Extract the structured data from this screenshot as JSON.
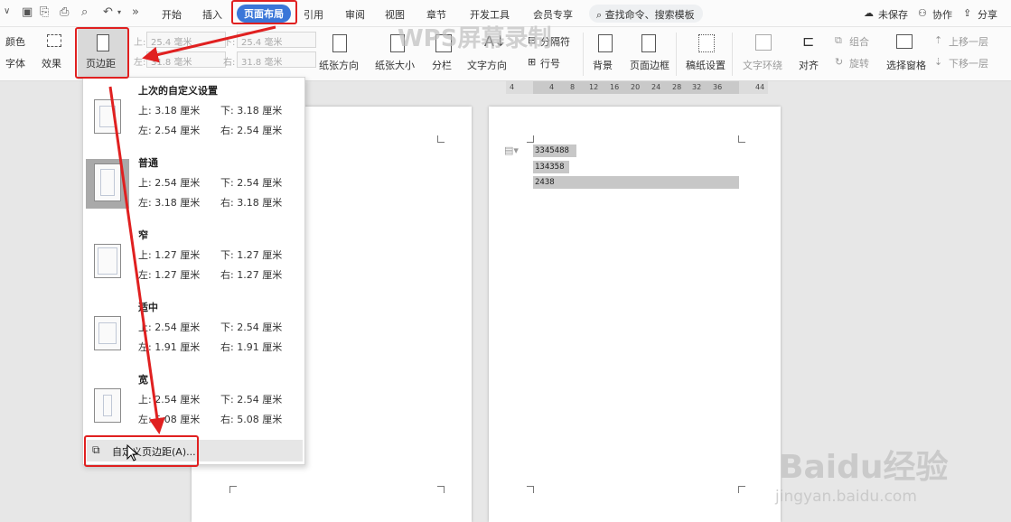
{
  "toolbar": {
    "tabs": [
      "开始",
      "插入",
      "页面布局",
      "引用",
      "审阅",
      "视图",
      "章节",
      "开发工具",
      "会员专享"
    ],
    "search_label": "查找命令、搜索模板",
    "unsaved": "未保存",
    "collab": "协作",
    "share": "分享"
  },
  "ribbon": {
    "color": "颜色",
    "font": "字体",
    "effects": "效果",
    "margins": "页边距",
    "top_lbl": "上:",
    "top_val": "25.4 毫米",
    "bottom_lbl": "下:",
    "bottom_val": "25.4 毫米",
    "left_lbl": "左:",
    "left_val": "31.8 毫米",
    "right_lbl": "右:",
    "right_val": "31.8 毫米",
    "orientation": "纸张方向",
    "size": "纸张大小",
    "columns": "分栏",
    "text_direction": "文字方向",
    "breaks": "分隔符",
    "line_numbers": "行号",
    "background": "背景",
    "page_border": "页面边框",
    "draft_setup": "稿纸设置",
    "text_wrap": "文字环绕",
    "align": "对齐",
    "group": "组合",
    "rotate": "旋转",
    "selection_pane": "选择窗格",
    "bring_forward": "上移一层",
    "send_backward": "下移一层"
  },
  "ruler": [
    "4",
    "4",
    "8",
    "12",
    "16",
    "20",
    "24",
    "28",
    "32",
    "36",
    "44"
  ],
  "document": {
    "lines": [
      "3345488",
      "134358",
      "2438"
    ]
  },
  "margins_menu": {
    "options": [
      {
        "title": "上次的自定义设置",
        "top": "上: 3.18 厘米",
        "bottom": "下: 3.18 厘米",
        "left": "左: 2.54 厘米",
        "right": "右: 2.54 厘米"
      },
      {
        "title": "普通",
        "top": "上: 2.54 厘米",
        "bottom": "下: 2.54 厘米",
        "left": "左: 3.18 厘米",
        "right": "右: 3.18 厘米"
      },
      {
        "title": "窄",
        "top": "上: 1.27 厘米",
        "bottom": "下: 1.27 厘米",
        "left": "左: 1.27 厘米",
        "right": "右: 1.27 厘米"
      },
      {
        "title": "适中",
        "top": "上: 2.54 厘米",
        "bottom": "下: 2.54 厘米",
        "left": "左: 1.91 厘米",
        "right": "右: 1.91 厘米"
      },
      {
        "title": "宽",
        "top": "上: 2.54 厘米",
        "bottom": "下: 2.54 厘米",
        "left": "左: 5.08 厘米",
        "right": "右: 5.08 厘米"
      }
    ],
    "custom": "自定义页边距(A)..."
  },
  "watermarks": {
    "wps": "WPS屏幕录制",
    "baidu": "Baidu经验",
    "url": "jingyan.baidu.com"
  }
}
